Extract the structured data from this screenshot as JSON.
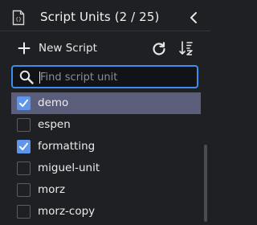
{
  "header": {
    "title": "Script Units (2 / 25)"
  },
  "toolbar": {
    "new_label": "New Script"
  },
  "search": {
    "placeholder": "Find script unit",
    "value": ""
  },
  "units": [
    {
      "label": "demo",
      "checked": true,
      "selected": true
    },
    {
      "label": "espen",
      "checked": false,
      "selected": false
    },
    {
      "label": "formatting",
      "checked": true,
      "selected": false
    },
    {
      "label": "miguel-unit",
      "checked": false,
      "selected": false
    },
    {
      "label": "morz",
      "checked": false,
      "selected": false
    },
    {
      "label": "morz-copy",
      "checked": false,
      "selected": false
    }
  ],
  "colors": {
    "accent": "#3f8cf0",
    "checkbox": "#5e96ec",
    "selected_row": "#5b5e7a",
    "background": "#1f2023"
  }
}
